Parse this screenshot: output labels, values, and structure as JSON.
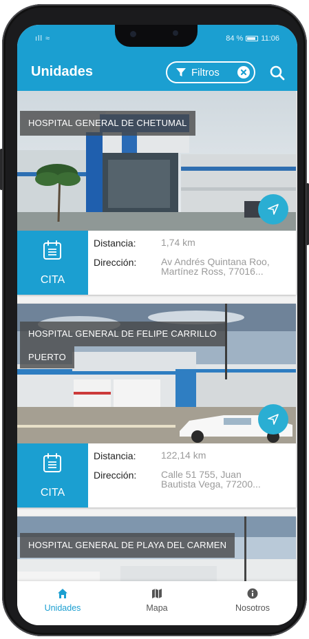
{
  "status_bar": {
    "signal_text": "ıll ≈",
    "battery_percent": "84 %",
    "time": "11:06"
  },
  "app_bar": {
    "title": "Unidades",
    "filter_label": "Filtros",
    "filter_icon": "funnel-icon",
    "clear_icon": "close-circle-icon",
    "search_icon": "search-icon"
  },
  "cards": [
    {
      "title": "HOSPITAL GENERAL DE CHETUMAL",
      "cita_label": "CITA",
      "distance_label": "Distancia:",
      "distance_value": "1,74 km",
      "address_label": "Dirección:",
      "address_line1": "Av Andrés Quintana Roo,",
      "address_line2": "Martínez Ross, 77016..."
    },
    {
      "title": "HOSPITAL GENERAL DE FELIPE CARRILLO",
      "title_line2": "PUERTO",
      "cita_label": "CITA",
      "distance_label": "Distancia:",
      "distance_value": "122,14 km",
      "address_label": "Dirección:",
      "address_line1": "Calle 51 755, Juan",
      "address_line2": "Bautista Vega, 77200..."
    },
    {
      "title": "HOSPITAL GENERAL DE PLAYA DEL CARMEN"
    }
  ],
  "bottom_nav": [
    {
      "label": "Unidades",
      "icon": "home-icon",
      "active": true
    },
    {
      "label": "Mapa",
      "icon": "map-icon",
      "active": false
    },
    {
      "label": "Nosotros",
      "icon": "info-icon",
      "active": false
    }
  ],
  "colors": {
    "primary": "#1b9fd1",
    "fab": "#2aaed3",
    "value_text": "#9a9a9a"
  }
}
